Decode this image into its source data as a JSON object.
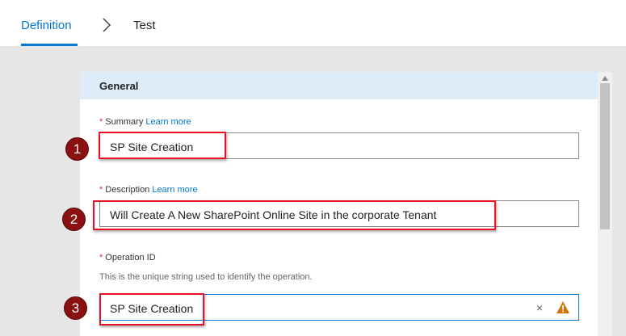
{
  "tabs": {
    "definition": "Definition",
    "test": "Test"
  },
  "section": {
    "title": "General"
  },
  "fields": {
    "summary": {
      "required_mark": "*",
      "label": "Summary",
      "learn_more": "Learn more",
      "value": "SP Site Creation"
    },
    "description": {
      "required_mark": "*",
      "label": "Description",
      "learn_more": "Learn more",
      "value": "Will Create A New SharePoint Online Site in the corporate Tenant"
    },
    "operation_id": {
      "required_mark": "*",
      "label": "Operation ID",
      "hint": "This is the unique string used to identify the operation.",
      "value": "SP Site Creation",
      "clear_glyph": "×"
    }
  },
  "callouts": [
    "1",
    "2",
    "3"
  ],
  "colors": {
    "accent": "#0078d4",
    "header_bg": "#deecf9",
    "required": "#d13438",
    "annotation": "#e81123",
    "callout": "#8b1010",
    "warning": "#d47500"
  },
  "icons": {
    "breadcrumb": "chevron-right-icon",
    "clear": "clear-icon",
    "warning": "warning-icon"
  }
}
